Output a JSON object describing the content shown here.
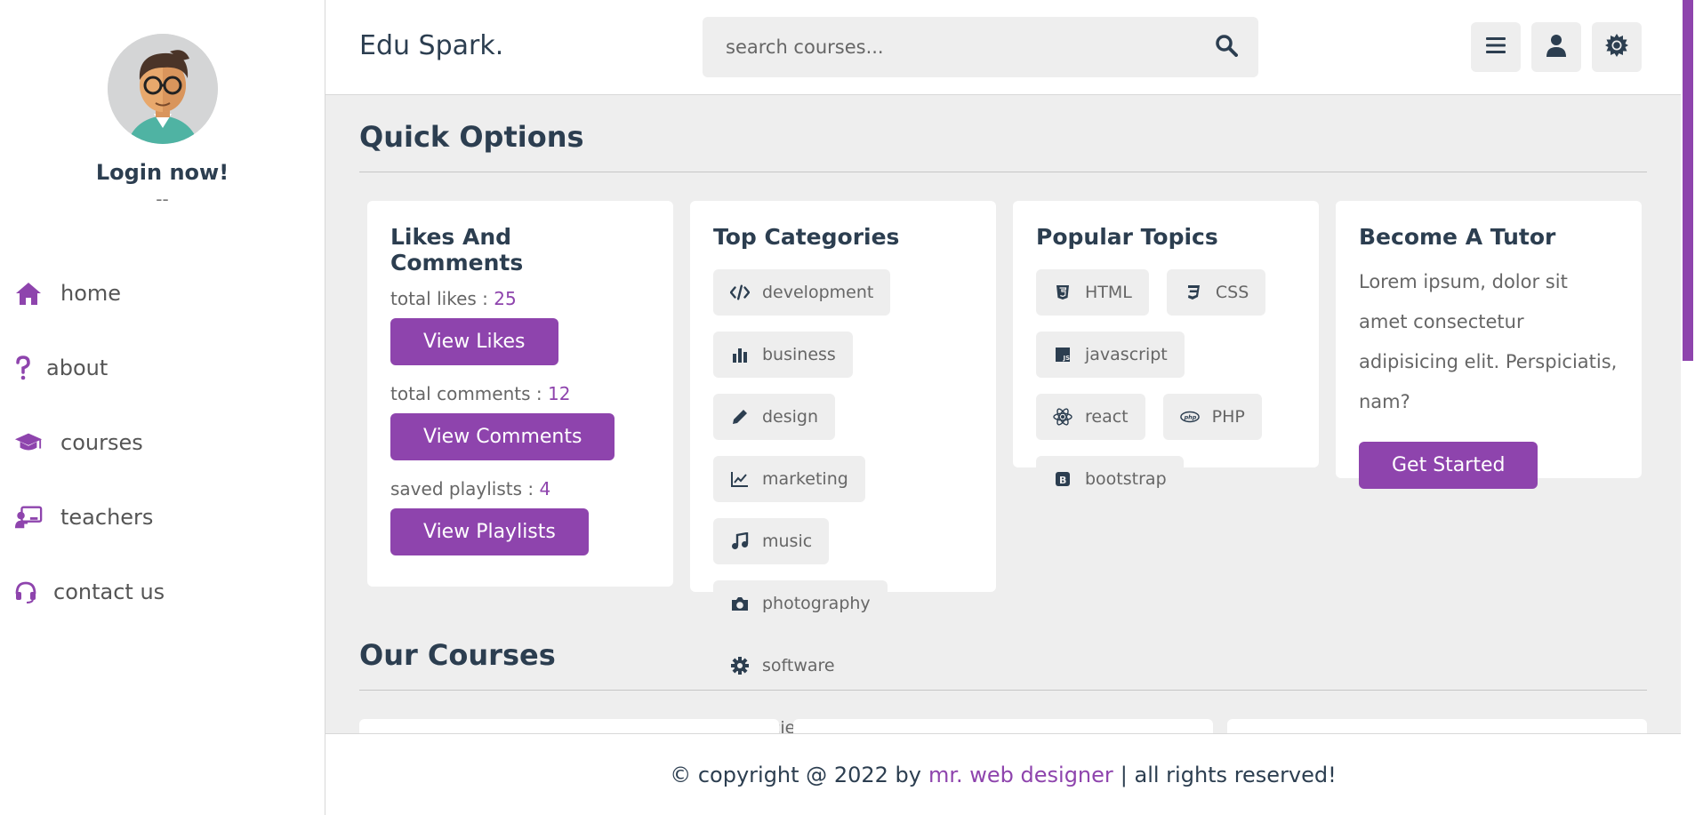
{
  "sidebar": {
    "profile": {
      "name": "Login now!",
      "role": "--"
    },
    "nav": [
      {
        "label": "home",
        "icon": "home-icon"
      },
      {
        "label": "about",
        "icon": "question-icon"
      },
      {
        "label": "courses",
        "icon": "graduation-cap-icon"
      },
      {
        "label": "teachers",
        "icon": "chalkboard-teacher-icon"
      },
      {
        "label": "contact us",
        "icon": "headset-icon"
      }
    ]
  },
  "header": {
    "logo": "Edu Spark.",
    "search_placeholder": "search courses...",
    "buttons": [
      "menu-icon",
      "user-icon",
      "sun-icon"
    ]
  },
  "main": {
    "quick_options_title": "Quick Options",
    "likes_card": {
      "title": "Likes And Comments",
      "likes_label": "total likes : ",
      "likes_value": "25",
      "view_likes": "View Likes",
      "comments_label": "total comments : ",
      "comments_value": "12",
      "view_comments": "View Comments",
      "playlists_label": "saved playlists : ",
      "playlists_value": "4",
      "view_playlists": "View Playlists"
    },
    "categories_card": {
      "title": "Top Categories",
      "tags": [
        {
          "label": "development",
          "icon": "code-icon"
        },
        {
          "label": "business",
          "icon": "bar-chart-icon"
        },
        {
          "label": "design",
          "icon": "pen-icon"
        },
        {
          "label": "marketing",
          "icon": "line-chart-icon"
        },
        {
          "label": "music",
          "icon": "music-icon"
        },
        {
          "label": "photography",
          "icon": "camera-icon"
        },
        {
          "label": "software",
          "icon": "cog-icon"
        },
        {
          "label": "science",
          "icon": "vial-icon"
        }
      ]
    },
    "topics_card": {
      "title": "Popular Topics",
      "tags": [
        {
          "label": "HTML",
          "icon": "html5-icon"
        },
        {
          "label": "CSS",
          "icon": "css3-icon"
        },
        {
          "label": "javascript",
          "icon": "js-icon"
        },
        {
          "label": "react",
          "icon": "react-icon"
        },
        {
          "label": "PHP",
          "icon": "php-icon"
        },
        {
          "label": "bootstrap",
          "icon": "bootstrap-icon"
        }
      ]
    },
    "tutor_card": {
      "title": "Become A Tutor",
      "text": "Lorem ipsum, dolor sit amet consectetur adipisicing elit. Perspiciatis, nam?",
      "button": "Get Started"
    },
    "our_courses_title": "Our Courses"
  },
  "footer": {
    "prefix": "© copyright @ 2022 by",
    "author": "mr. web designer",
    "suffix": "| all rights reserved!"
  },
  "colors": {
    "accent": "#8e44ad",
    "text": "#2c3e50",
    "background": "#eeeeee"
  }
}
